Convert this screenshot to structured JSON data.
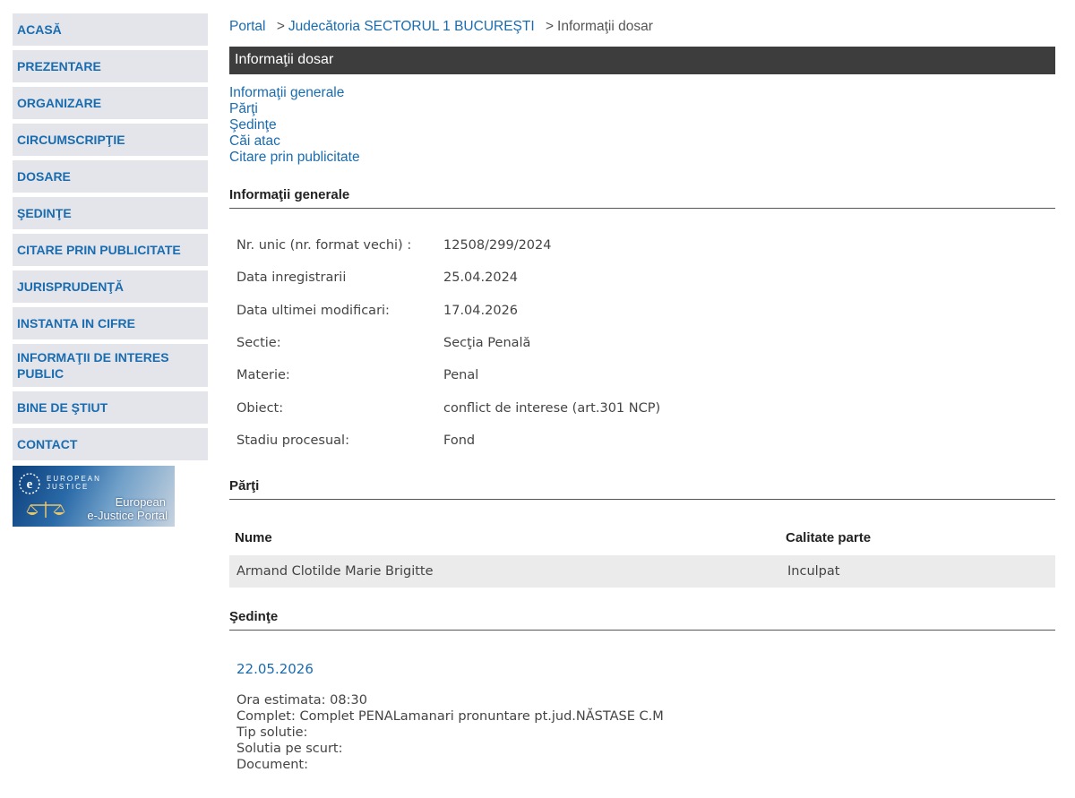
{
  "sidebar": {
    "items": [
      {
        "label": "ACASĂ"
      },
      {
        "label": "PREZENTARE"
      },
      {
        "label": "ORGANIZARE"
      },
      {
        "label": "CIRCUMSCRIPŢIE"
      },
      {
        "label": "DOSARE"
      },
      {
        "label": "ŞEDINŢE"
      },
      {
        "label": "CITARE PRIN PUBLICITATE"
      },
      {
        "label": "JURISPRUDENŢĂ"
      },
      {
        "label": "INSTANTA IN CIFRE"
      },
      {
        "label": "INFORMAŢII DE INTERES PUBLIC"
      },
      {
        "label": "BINE DE ŞTIUT"
      },
      {
        "label": "CONTACT"
      }
    ],
    "banner": {
      "logo_top": "EUROPEAN",
      "logo_sub": "JUSTICE",
      "title_line1": "European",
      "title_line2": "e-Justice Portal"
    }
  },
  "breadcrumb": {
    "portal": "Portal",
    "court": "Judecătoria SECTORUL 1 BUCUREŞTI",
    "current": "Informaţii dosar",
    "separator": ">"
  },
  "page_title": "Informaţii dosar",
  "anchors": [
    {
      "label": "Informaţii generale"
    },
    {
      "label": "Părţi"
    },
    {
      "label": "Şedinţe"
    },
    {
      "label": "Căi atac"
    },
    {
      "label": "Citare prin publicitate"
    }
  ],
  "general": {
    "heading": "Informaţii generale",
    "rows": [
      {
        "label": "Nr. unic (nr. format vechi) :",
        "value": "12508/299/2024"
      },
      {
        "label": "Data inregistrarii",
        "value": "25.04.2024"
      },
      {
        "label": "Data ultimei modificari:",
        "value": "17.04.2026"
      },
      {
        "label": "Sectie:",
        "value": "Secţia Penală"
      },
      {
        "label": "Materie:",
        "value": "Penal"
      },
      {
        "label": "Obiect:",
        "value": "conflict de interese (art.301 NCP)"
      },
      {
        "label": "Stadiu procesual:",
        "value": "Fond"
      }
    ]
  },
  "parties": {
    "heading": "Părţi",
    "columns": {
      "name": "Nume",
      "role": "Calitate parte"
    },
    "rows": [
      {
        "name": "Armand Clotilde Marie Brigitte",
        "role": "Inculpat"
      }
    ]
  },
  "hearings": {
    "heading": "Şedinţe",
    "items": [
      {
        "date": "22.05.2026",
        "ora": "Ora estimata: 08:30",
        "complet": "Complet: Complet PENALamanari pronuntare pt.jud.NĂSTASE C.M",
        "tip_solutie": "Tip solutie:",
        "solutia": "Solutia pe scurt:",
        "document": "Document:"
      }
    ]
  },
  "colors": {
    "link": "#1a6cb0",
    "sidebar_bg": "#e3e5ea",
    "titlebar_bg": "#3d3d3d",
    "row_bg": "#ebebeb"
  },
  "icons": [
    "e-justice-logo-icon",
    "scales-of-justice-icon"
  ]
}
